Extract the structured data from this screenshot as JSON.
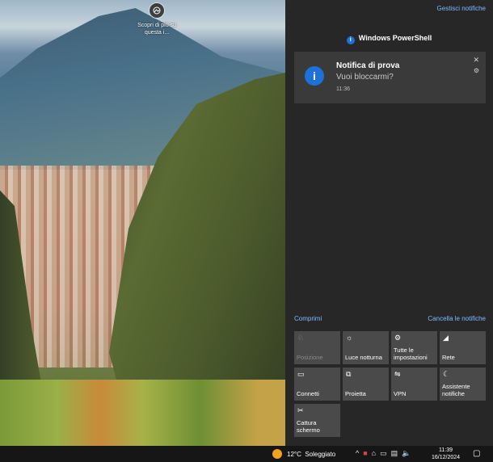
{
  "desktop": {
    "spotlight_label": "Scopri di più su questa i..."
  },
  "action_center": {
    "manage_link": "Gestisci notifiche",
    "app_group": {
      "name": "Windows PowerShell",
      "icon": "info-icon"
    },
    "notification": {
      "title": "Notifica di prova",
      "body": "Vuoi bloccarmi?",
      "time": "11:36"
    },
    "collapse_link": "Comprimi",
    "clear_all_link": "Cancella le notifiche",
    "quick_actions": [
      {
        "label": "Posizione",
        "icon": "location-icon",
        "enabled": false
      },
      {
        "label": "Luce notturna",
        "icon": "brightness-icon",
        "enabled": true
      },
      {
        "label": "Tutte le impostazioni",
        "icon": "gear-icon",
        "enabled": true
      },
      {
        "label": "Rete",
        "icon": "network-icon",
        "enabled": true
      },
      {
        "label": "Connetti",
        "icon": "connect-icon",
        "enabled": true
      },
      {
        "label": "Proietta",
        "icon": "project-icon",
        "enabled": true
      },
      {
        "label": "VPN",
        "icon": "vpn-icon",
        "enabled": true
      },
      {
        "label": "Assistente notifiche",
        "icon": "moon-icon",
        "enabled": true
      },
      {
        "label": "Cattura schermo",
        "icon": "screen-snip-icon",
        "enabled": true
      }
    ]
  },
  "taskbar": {
    "weather_temp": "12°C",
    "weather_desc": "Soleggiato",
    "time": "11:39",
    "date": "16/12/2024"
  },
  "colors": {
    "accent_blue": "#1d71d8",
    "link_blue": "#7bbcff",
    "panel_bg": "#272727",
    "tile_bg": "#4a4a4a"
  }
}
